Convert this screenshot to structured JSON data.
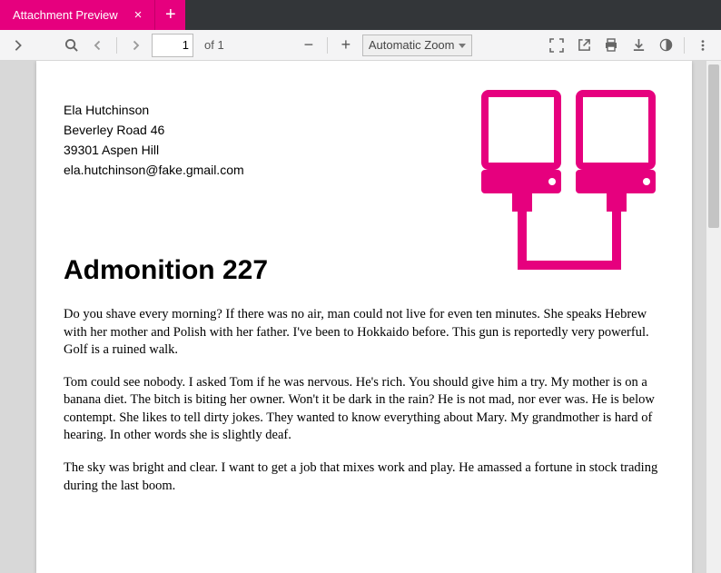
{
  "tab": {
    "title": "Attachment Preview",
    "close": "×",
    "add": "+"
  },
  "toolbar": {
    "page_current": "1",
    "page_count": "of 1",
    "minus": "−",
    "plus": "+",
    "zoom_selected": "Automatic Zoom"
  },
  "document": {
    "sender": {
      "name": "Ela Hutchinson",
      "street": "Beverley Road 46",
      "city": "39301 Aspen Hill",
      "email": "ela.hutchinson@fake.gmail.com"
    },
    "title": "Admonition 227",
    "paragraphs": [
      "Do you shave every morning? If there was no air, man could not live for even ten minutes. She speaks Hebrew with her mother and Polish with her father. I've been to Hokkaido before. This gun is reportedly very powerful. Golf is a ruined walk.",
      "Tom could see nobody. I asked Tom if he was nervous. He's rich. You should give him a try. My mother is on a banana diet. The bitch is biting her owner. Won't it be dark in the rain? He is not mad, nor ever was. He is below contempt. She likes to tell dirty jokes. They wanted to know everything about Mary. My grandmother is hard of hearing. In other words she is slightly deaf.",
      "The sky was bright and clear. I want to get a job that mixes work and play. He amassed a fortune in stock trading during the last boom."
    ]
  },
  "colors": {
    "accent": "#e6007e"
  }
}
